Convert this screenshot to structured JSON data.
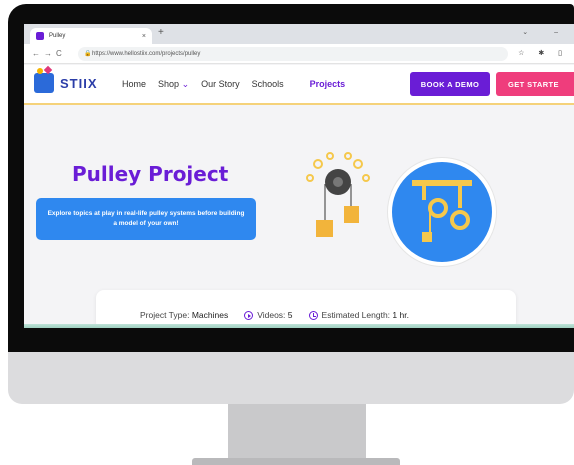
{
  "browser": {
    "tab_title": "Pulley",
    "tab_close": "×",
    "new_tab": "+",
    "url": "https://www.hellostiix.com/projects/pulley"
  },
  "site": {
    "logo_text": "STIIX",
    "nav": [
      "Home",
      "Shop",
      "Our Story",
      "Schools",
      "Projects"
    ],
    "shop_caret": "⌄",
    "book_demo": "BOOK A DEMO",
    "get_started": "GET STARTE"
  },
  "hero": {
    "title": "Pulley Project",
    "description": "Explore topics at play in real-life pulley systems before building a model of your own!"
  },
  "info": {
    "project_type_label": "Project Type:",
    "project_type_value": "Machines",
    "videos_label": "Videos:",
    "videos_value": "5",
    "length_label": "Estimated Length:",
    "length_value": "1 hr."
  },
  "colors": {
    "brand_purple": "#6a1dd6",
    "brand_pink": "#ef3d7c",
    "brand_blue": "#2f88ef",
    "accent_yellow": "#f5c84c"
  }
}
